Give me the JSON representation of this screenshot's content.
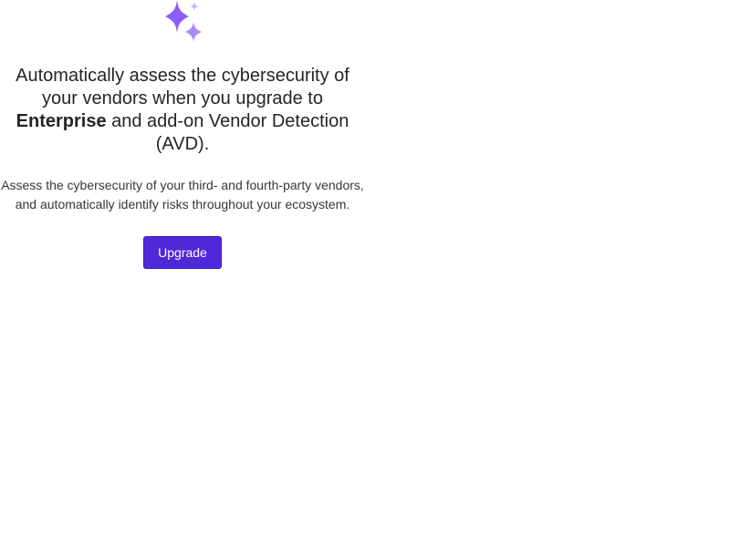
{
  "icon": {
    "name": "sparkle-icon",
    "color_main": "#8b5cf6",
    "color_light": "#a78bfa",
    "color_faint": "#c4b5fd"
  },
  "headline": {
    "part1": "Automatically assess the cybersecurity of your vendors when you upgrade to ",
    "bold": "Enterprise",
    "part2": " and add-on Vendor Detection (AVD)."
  },
  "description": "Assess the cybersecurity of your third- and fourth-party vendors, and automatically identify risks throughout your ecosystem.",
  "upgrade_button": {
    "label": "Upgrade",
    "color": "#4f28d8"
  }
}
